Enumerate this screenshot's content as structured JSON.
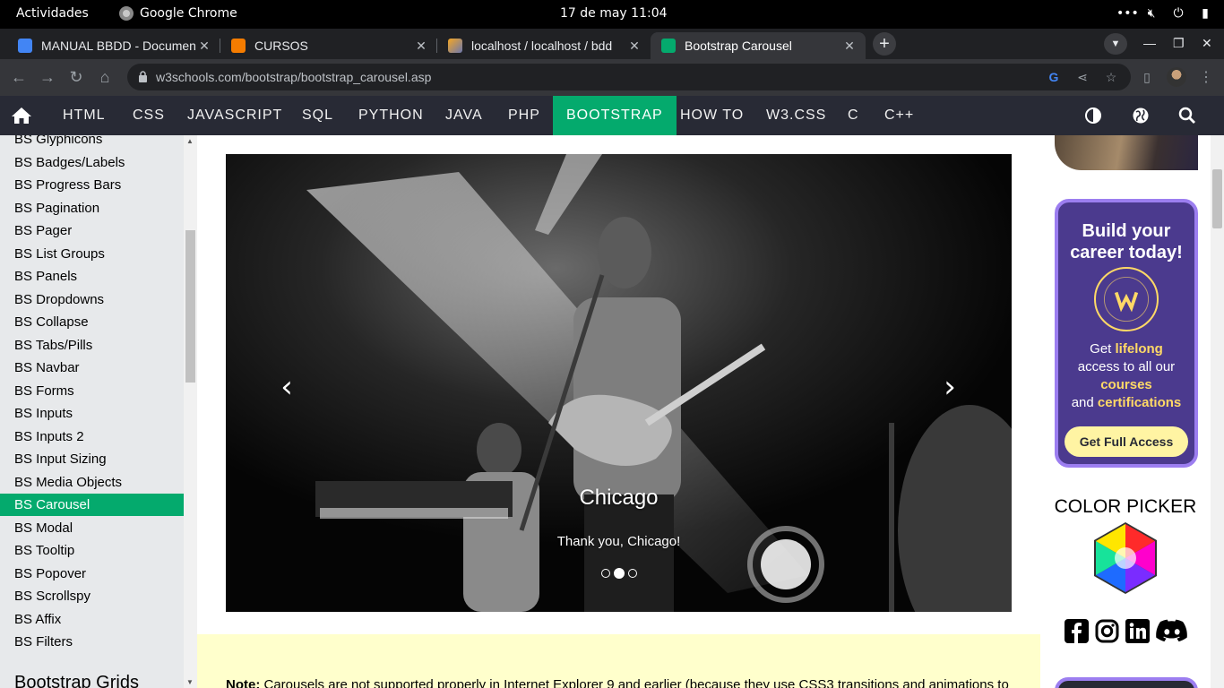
{
  "os_bar": {
    "activities": "Actividades",
    "app_name": "Google Chrome",
    "datetime": "17 de may  11:04"
  },
  "tabs": [
    {
      "label": "MANUAL BBDD - Documen",
      "favicon": "docs-icon",
      "color": "#4285f4"
    },
    {
      "label": "CURSOS",
      "favicon": "xampp-icon",
      "color": "#f57c00"
    },
    {
      "label": "localhost / localhost / bdd",
      "favicon": "phpmyadmin-icon",
      "color": "#f5a623"
    },
    {
      "label": "Bootstrap Carousel",
      "favicon": "w3schools-icon",
      "color": "#04aa6d"
    }
  ],
  "address_bar": {
    "url": "w3schools.com/bootstrap/bootstrap_carousel.asp"
  },
  "w3nav": {
    "links": [
      "HTML",
      "CSS",
      "JAVASCRIPT",
      "SQL",
      "PYTHON",
      "JAVA",
      "PHP",
      "BOOTSTRAP",
      "HOW TO",
      "W3.CSS",
      "C",
      "C++"
    ],
    "active": "BOOTSTRAP"
  },
  "sidebar": {
    "items": [
      "BS Glyphicons",
      "BS Badges/Labels",
      "BS Progress Bars",
      "BS Pagination",
      "BS Pager",
      "BS List Groups",
      "BS Panels",
      "BS Dropdowns",
      "BS Collapse",
      "BS Tabs/Pills",
      "BS Navbar",
      "BS Forms",
      "BS Inputs",
      "BS Inputs 2",
      "BS Input Sizing",
      "BS Media Objects",
      "BS Carousel",
      "BS Modal",
      "BS Tooltip",
      "BS Popover",
      "BS Scrollspy",
      "BS Affix",
      "BS Filters"
    ],
    "active": "BS Carousel",
    "section_heading": "Bootstrap Grids"
  },
  "carousel": {
    "caption_title": "Chicago",
    "caption_text": "Thank you, Chicago!",
    "slide_count": 3,
    "active_slide": 2
  },
  "note": {
    "label": "Note:",
    "text": " Carousels are not supported properly in Internet Explorer 9 and earlier (because they use CSS3 transitions and animations to"
  },
  "promo": {
    "title": "Build your career today!",
    "line1_pre": "Get ",
    "line1_hl": "lifelong",
    "line2": "access to all our",
    "line3_hl": "courses",
    "line4_pre": "and ",
    "line4_hl": "certifications",
    "cta": "Get Full Access"
  },
  "color_picker": {
    "title": "COLOR PICKER"
  },
  "social_icons": [
    "facebook-icon",
    "instagram-icon",
    "linkedin-icon",
    "discord-icon"
  ],
  "colors": {
    "w3_green": "#04aa6d",
    "w3_dark": "#282a35",
    "note_bg": "#ffffcc",
    "promo_purple": "#4b3a8e"
  }
}
